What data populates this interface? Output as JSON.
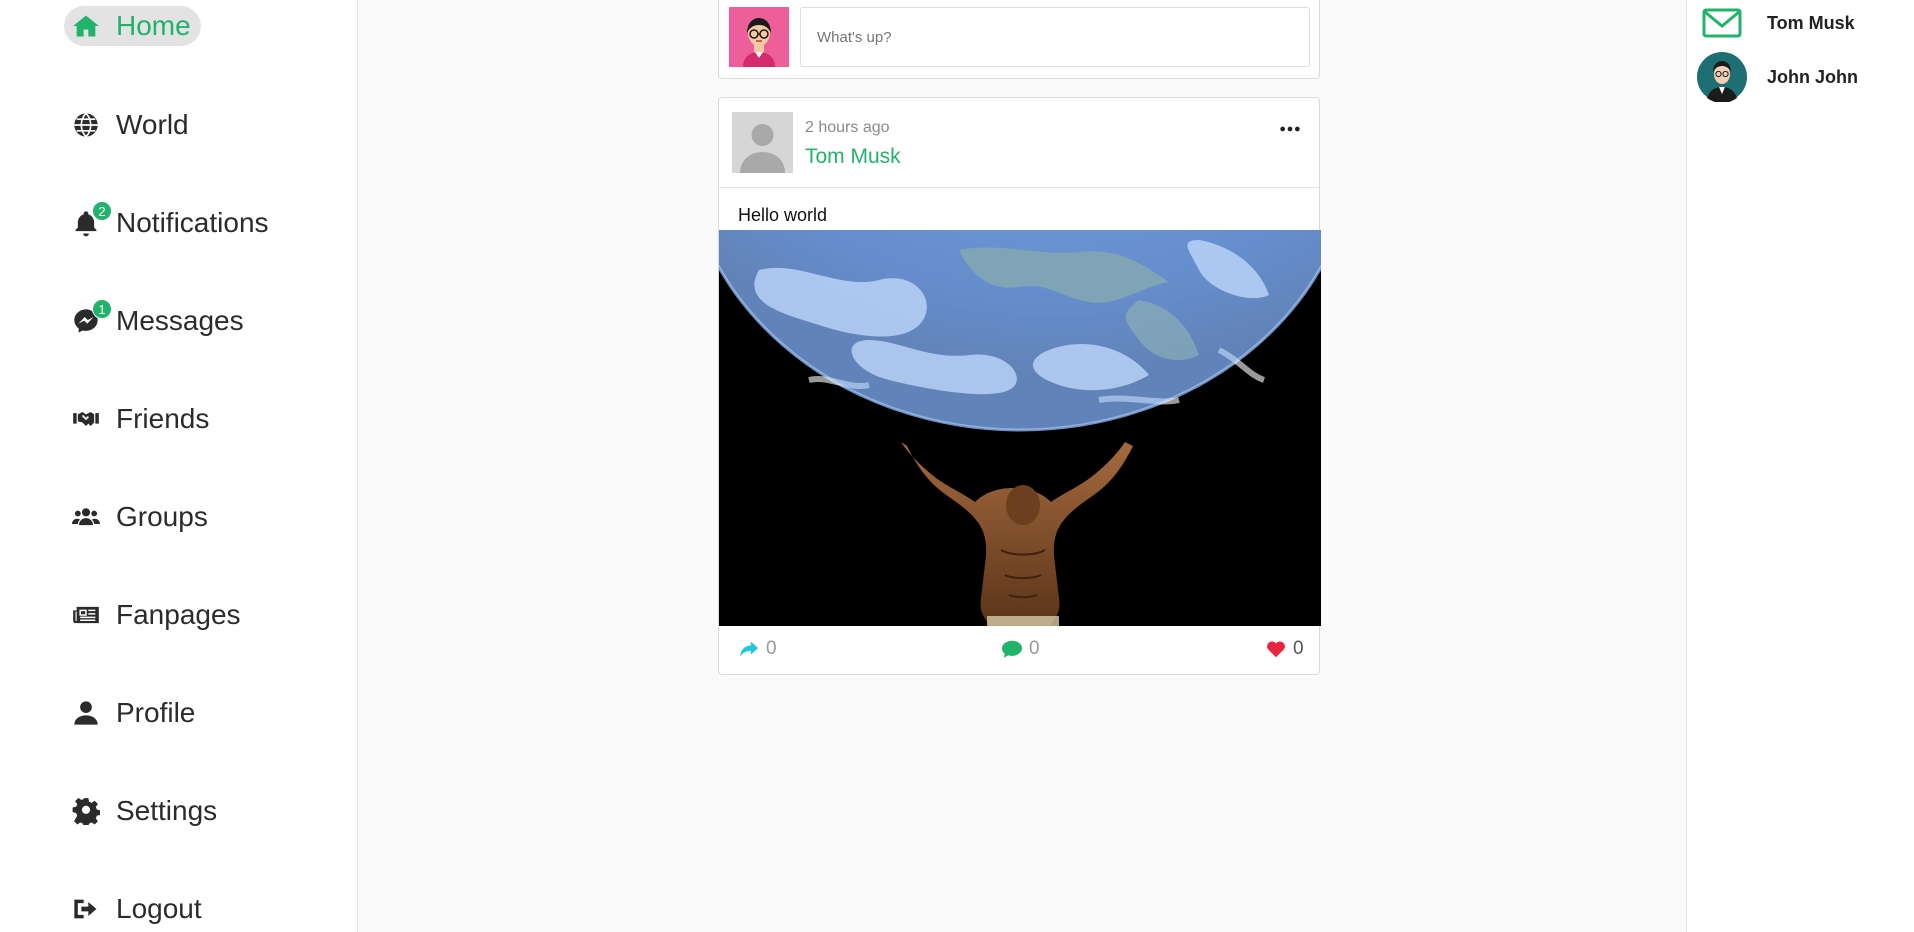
{
  "nav": {
    "items": [
      {
        "label": "Home",
        "icon": "home-icon",
        "active": true
      },
      {
        "label": "World",
        "icon": "globe-icon"
      },
      {
        "label": "Notifications",
        "icon": "bell-icon",
        "badge": "2"
      },
      {
        "label": "Messages",
        "icon": "messenger-icon",
        "badge": "1"
      },
      {
        "label": "Friends",
        "icon": "handshake-icon"
      },
      {
        "label": "Groups",
        "icon": "users-icon"
      },
      {
        "label": "Fanpages",
        "icon": "newspaper-icon"
      },
      {
        "label": "Profile",
        "icon": "user-icon"
      },
      {
        "label": "Settings",
        "icon": "gear-icon"
      },
      {
        "label": "Logout",
        "icon": "sign-out-icon"
      }
    ]
  },
  "composer": {
    "placeholder": "What's up?"
  },
  "post": {
    "time": "2 hours ago",
    "author": "Tom Musk",
    "text": "Hello world",
    "shares": "0",
    "comments": "0",
    "likes": "0"
  },
  "contacts": [
    {
      "name": "Tom Musk",
      "icon": "envelope-icon"
    },
    {
      "name": "John John",
      "icon": "avatar"
    }
  ],
  "colors": {
    "accent": "#22b36b",
    "share": "#1fc7d8",
    "like": "#e8253d"
  }
}
